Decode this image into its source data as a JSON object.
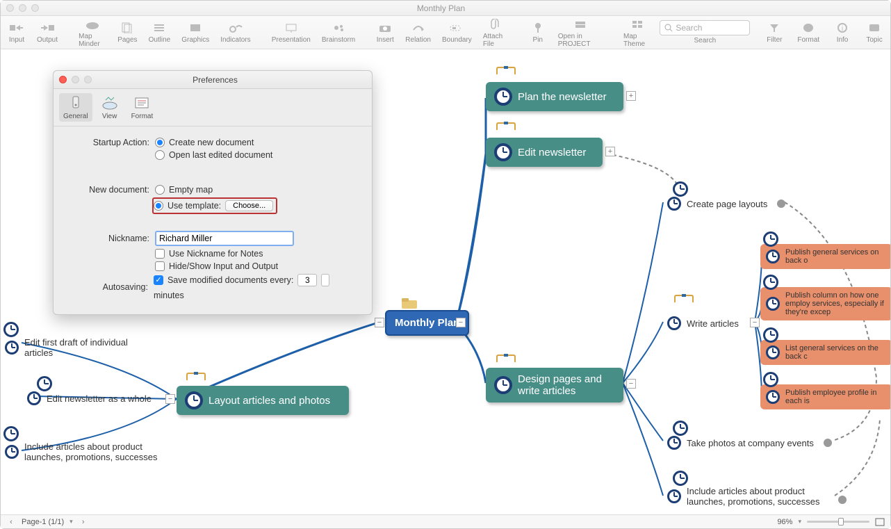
{
  "window": {
    "title": "Monthly Plan"
  },
  "toolbar": {
    "items": [
      "Input",
      "Output",
      "Map Minder",
      "Pages",
      "Outline",
      "Graphics",
      "Indicators",
      "Presentation",
      "Brainstorm",
      "Insert",
      "Relation",
      "Boundary",
      "Attach File",
      "Pin",
      "Open in PROJECT",
      "Map Theme"
    ],
    "search_placeholder": "Search",
    "search_label": "Search",
    "right": [
      "Filter",
      "Format",
      "Info",
      "Topic"
    ]
  },
  "statusbar": {
    "page_label": "Page-1 (1/1)",
    "zoom": "96%"
  },
  "nodes": {
    "central": "Monthly Plan",
    "plan_newsletter": "Plan the newsletter",
    "edit_newsletter": "Edit newsletter",
    "design_pages": "Design pages and write articles",
    "layout_articles": "Layout articles and photos",
    "edit_first": "Edit first draft of individual articles",
    "edit_whole": "Edit newsletter as a whole",
    "include_articles": "Include articles about product launches, promotions, successes",
    "create_layouts": "Create page layouts",
    "write_articles": "Write articles",
    "take_photos": "Take photos at company events",
    "include_articles2": "Include articles about product launches, promotions, successes",
    "salmon1": "Publish general services on back o",
    "salmon2": "Publish column on how one employ services, especially if they're excep",
    "salmon3": "List general services on the back c",
    "salmon4": "Publish employee profile in each is"
  },
  "prefs": {
    "title": "Preferences",
    "tabs": {
      "general": "General",
      "view": "View",
      "format": "Format"
    },
    "labels": {
      "startup": "Startup Action:",
      "newdoc": "New document:",
      "nickname": "Nickname:",
      "autosave": "Autosaving:"
    },
    "options": {
      "create_doc": "Create new document",
      "open_last": "Open last edited document",
      "empty_map": "Empty map",
      "use_template": "Use template:",
      "choose": "Choose...",
      "use_nickname": "Use Nickname for Notes",
      "hide_show": "Hide/Show Input and Output",
      "save_every": "Save modified documents every:",
      "minutes": "minutes"
    },
    "values": {
      "nickname": "Richard Miller",
      "autosave_minutes": "3"
    }
  }
}
